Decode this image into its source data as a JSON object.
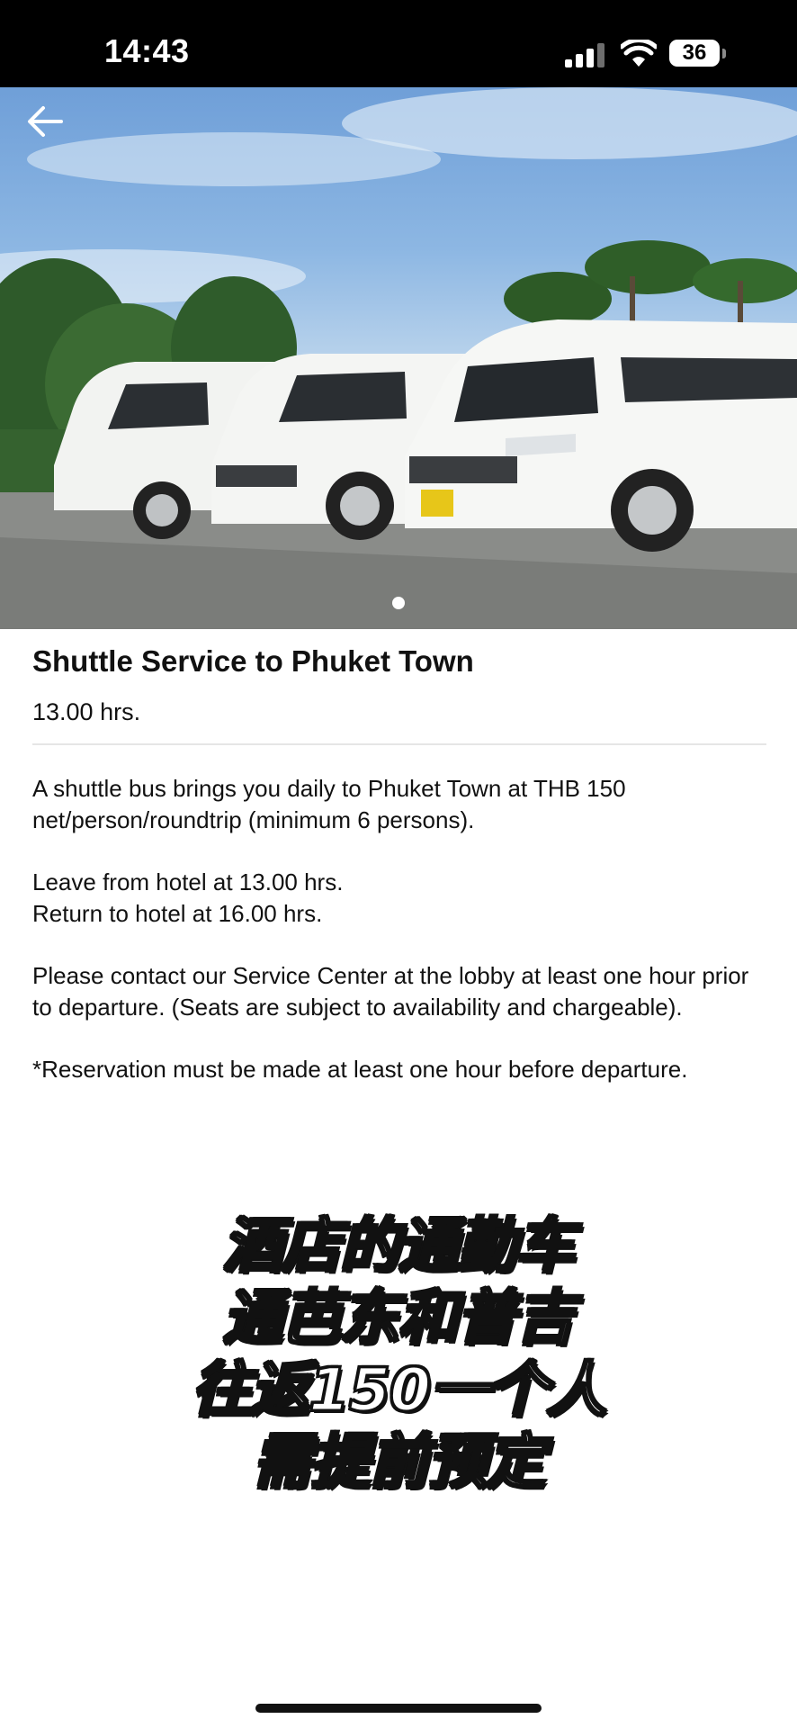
{
  "status_bar": {
    "time": "14:43",
    "battery": "36"
  },
  "hero": {
    "image_description": "three white vans",
    "active_slide": 1,
    "slide_count": 1
  },
  "content": {
    "title": "Shuttle Service to Phuket Town",
    "time": "13.00 hrs.",
    "paragraphs": [
      "A shuttle bus brings you daily to Phuket Town at THB 150 net/person/roundtrip (minimum 6 persons).",
      "Leave from hotel at 13.00 hrs.\nReturn to hotel at 16.00 hrs.",
      "Please contact our Service Center at the lobby at least one hour prior to departure. (Seats are subject to availability and chargeable).",
      "*Reservation must be made at least one hour before departure."
    ]
  },
  "overlay_caption": {
    "lines": [
      "酒店的通勤车",
      "通芭东和普吉",
      "往返150一个人",
      "需提前预定"
    ]
  },
  "icons": {
    "back": "arrow-left-icon",
    "signal": "cellular-signal-icon",
    "wifi": "wifi-icon",
    "battery": "battery-icon"
  }
}
